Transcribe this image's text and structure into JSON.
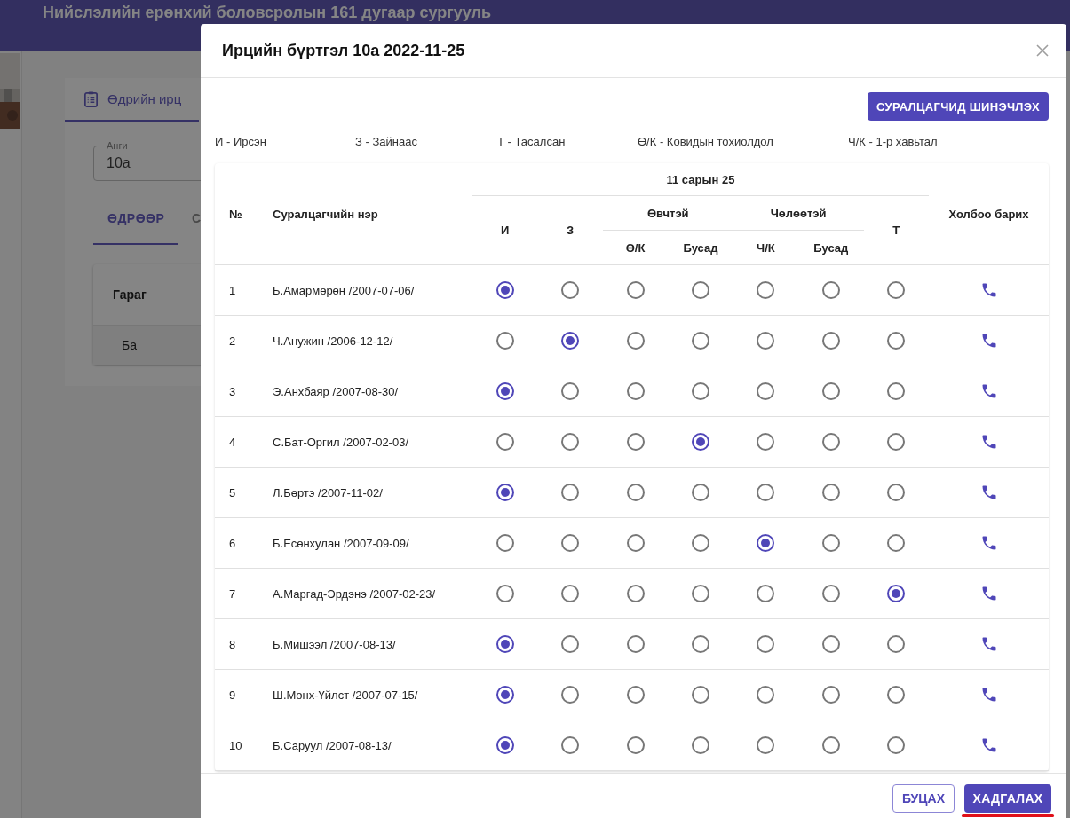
{
  "background": {
    "header_title": "Нийслэлийн ерөнхий боловсролын 161 дугаар сургууль",
    "tab": {
      "label": "Өдрийн ирц",
      "selected": true
    },
    "class_field": {
      "label": "Анги",
      "value": "10а"
    },
    "view_tabs": [
      {
        "label": "ӨДРӨӨР",
        "selected": true
      },
      {
        "label": "С",
        "selected": false
      }
    ],
    "table": {
      "column": "Гараг",
      "row": "Ба"
    }
  },
  "dialog": {
    "title": "Ирцийн бүртгэл 10а 2022-11-25",
    "refresh_button": "СУРАЛЦАГЧИД ШИНЭЧЛЭХ",
    "legend": [
      "И - Ирсэн",
      "З - Зайнаас",
      "Т - Тасалсан",
      "Ө/К - Ковидын тохиолдол",
      "Ч/К - 1-р хавьтал"
    ],
    "table": {
      "number_header": "№",
      "name_header": "Суралцагчийн нэр",
      "date_header": "11 сарын 25",
      "contact_header": "Холбоо барих",
      "status_columns": [
        {
          "label": "И"
        },
        {
          "label": "З"
        },
        {
          "label": "Өвчтэй",
          "children": [
            "Ө/К",
            "Бусад"
          ]
        },
        {
          "label": "Чөлөөтэй",
          "children": [
            "Ч/К",
            "Бусад"
          ]
        },
        {
          "label": "Т"
        }
      ],
      "rows": [
        {
          "number": "1",
          "name": "Б.Амармөрөн /2007-07-06/",
          "options": [
            {
              "selected": true
            },
            {
              "selected": false
            },
            {
              "selected": false
            },
            {
              "selected": false
            },
            {
              "selected": false
            },
            {
              "selected": false
            },
            {
              "selected": false
            }
          ]
        },
        {
          "number": "2",
          "name": "Ч.Анужин /2006-12-12/",
          "options": [
            {
              "selected": false
            },
            {
              "selected": true
            },
            {
              "selected": false
            },
            {
              "selected": false
            },
            {
              "selected": false
            },
            {
              "selected": false
            },
            {
              "selected": false
            }
          ]
        },
        {
          "number": "3",
          "name": "Э.Анхбаяр /2007-08-30/",
          "options": [
            {
              "selected": true
            },
            {
              "selected": false
            },
            {
              "selected": false
            },
            {
              "selected": false
            },
            {
              "selected": false
            },
            {
              "selected": false
            },
            {
              "selected": false
            }
          ]
        },
        {
          "number": "4",
          "name": "С.Бат-Оргил /2007-02-03/",
          "options": [
            {
              "selected": false
            },
            {
              "selected": false
            },
            {
              "selected": false
            },
            {
              "selected": true
            },
            {
              "selected": false
            },
            {
              "selected": false
            },
            {
              "selected": false
            }
          ]
        },
        {
          "number": "5",
          "name": "Л.Бөртэ /2007-11-02/",
          "options": [
            {
              "selected": true
            },
            {
              "selected": false
            },
            {
              "selected": false
            },
            {
              "selected": false
            },
            {
              "selected": false
            },
            {
              "selected": false
            },
            {
              "selected": false
            }
          ]
        },
        {
          "number": "6",
          "name": "Б.Есөнхулан /2007-09-09/",
          "options": [
            {
              "selected": false
            },
            {
              "selected": false
            },
            {
              "selected": false
            },
            {
              "selected": false
            },
            {
              "selected": true
            },
            {
              "selected": false
            },
            {
              "selected": false
            }
          ]
        },
        {
          "number": "7",
          "name": "А.Маргад-Эрдэнэ /2007-02-23/",
          "options": [
            {
              "selected": false
            },
            {
              "selected": false
            },
            {
              "selected": false
            },
            {
              "selected": false
            },
            {
              "selected": false
            },
            {
              "selected": false
            },
            {
              "selected": true
            }
          ]
        },
        {
          "number": "8",
          "name": "Б.Мишээл /2007-08-13/",
          "options": [
            {
              "selected": true
            },
            {
              "selected": false
            },
            {
              "selected": false
            },
            {
              "selected": false
            },
            {
              "selected": false
            },
            {
              "selected": false
            },
            {
              "selected": false
            }
          ]
        },
        {
          "number": "9",
          "name": "Ш.Мөнх-Үйлст /2007-07-15/",
          "options": [
            {
              "selected": true
            },
            {
              "selected": false
            },
            {
              "selected": false
            },
            {
              "selected": false
            },
            {
              "selected": false
            },
            {
              "selected": false
            },
            {
              "selected": false
            }
          ]
        },
        {
          "number": "10",
          "name": "Б.Саруул /2007-08-13/",
          "options": [
            {
              "selected": true
            },
            {
              "selected": false
            },
            {
              "selected": false
            },
            {
              "selected": false
            },
            {
              "selected": false
            },
            {
              "selected": false
            },
            {
              "selected": false
            }
          ]
        }
      ]
    },
    "buttons": [
      {
        "label": "БУЦАХ",
        "kind": "outlined"
      },
      {
        "label": "ХАДГАЛАХ",
        "kind": "filled"
      }
    ]
  }
}
